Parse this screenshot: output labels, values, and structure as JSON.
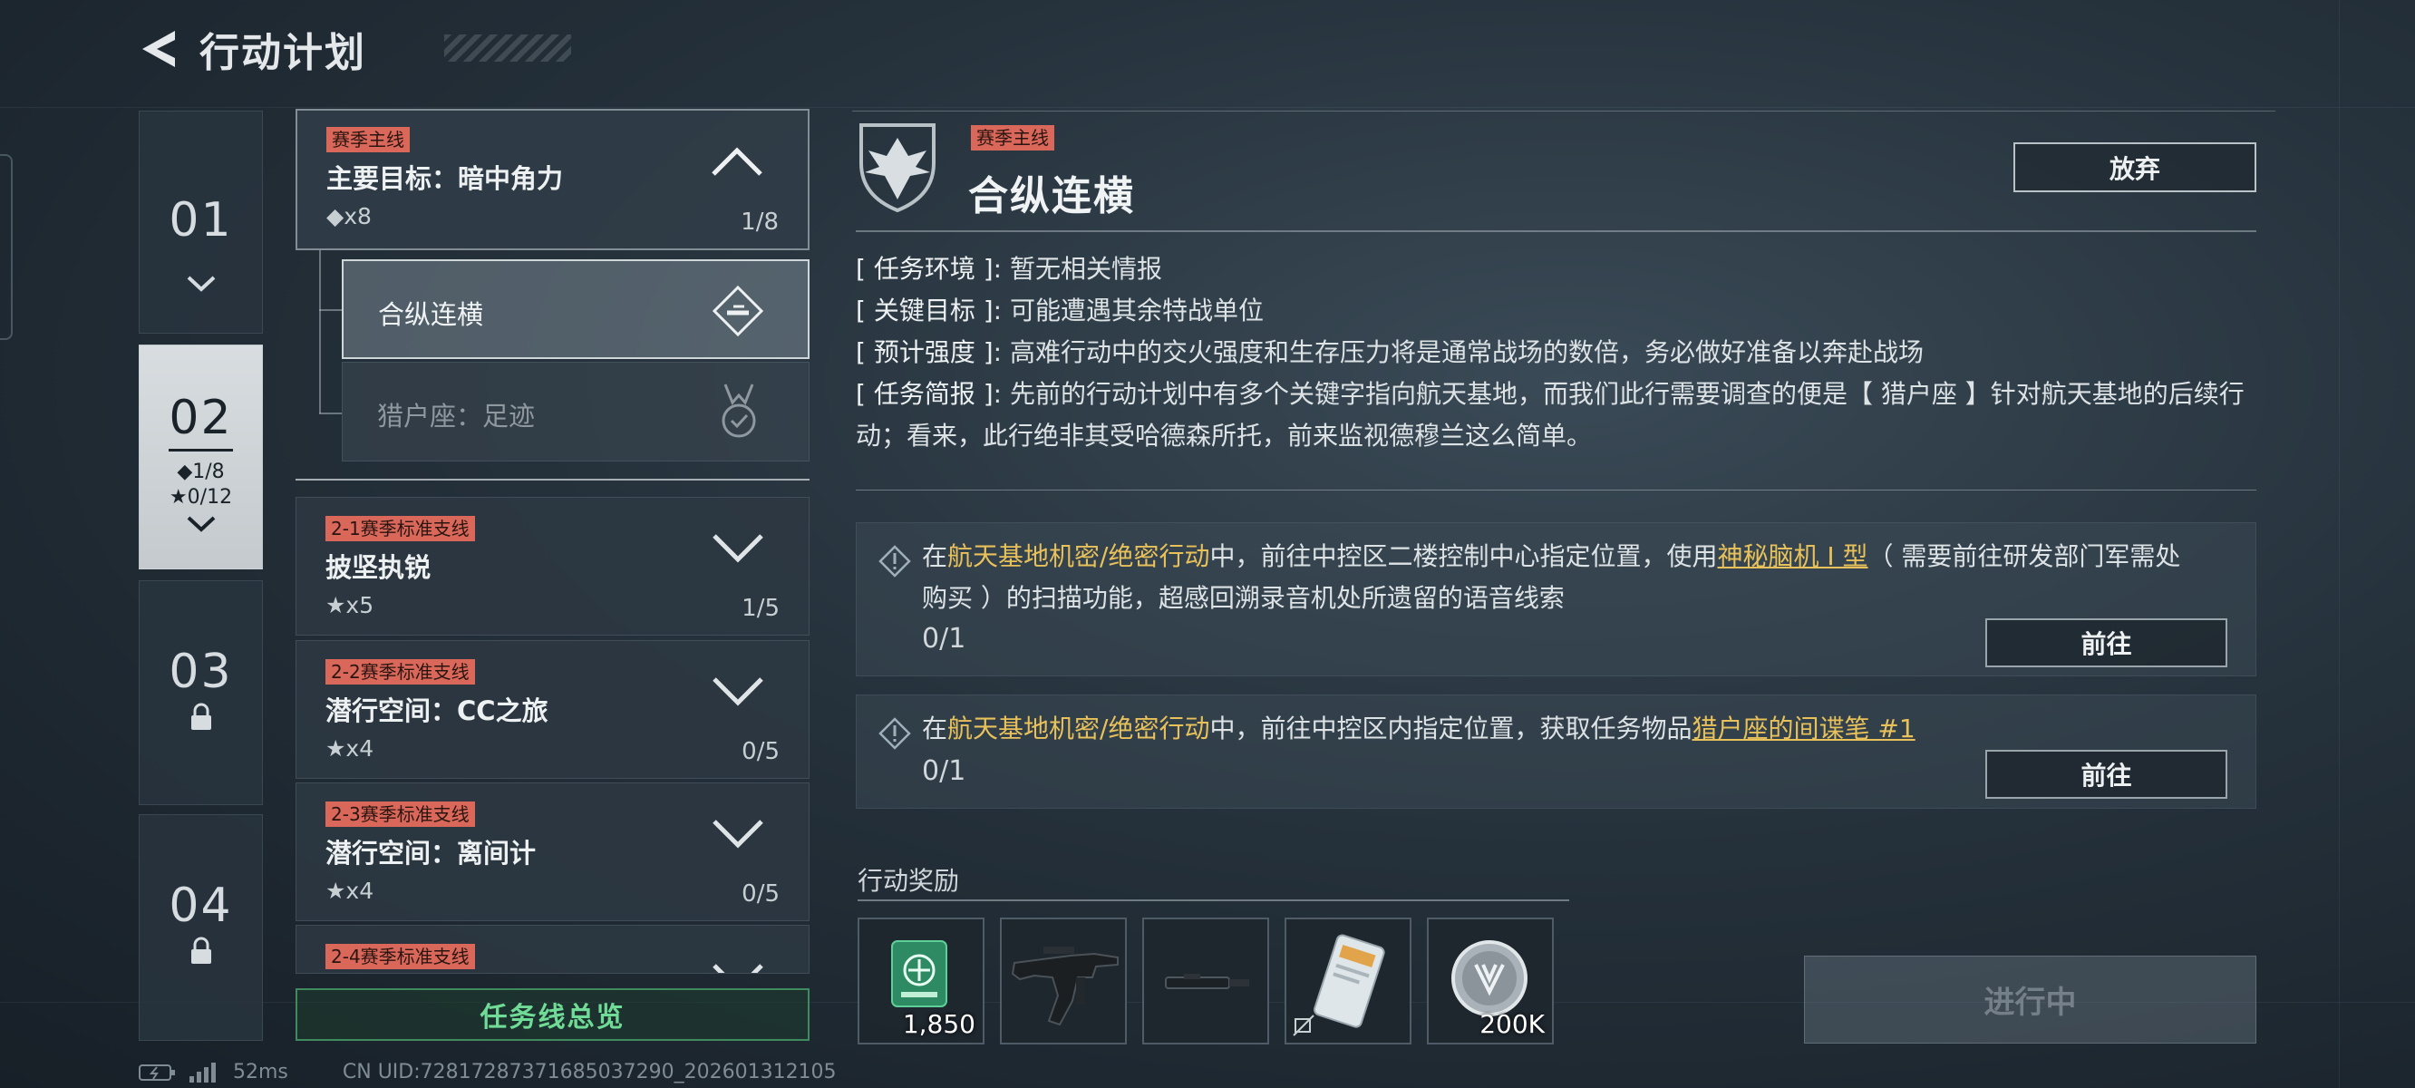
{
  "header": {
    "title": "行动计划"
  },
  "chapters": [
    {
      "num": "01"
    },
    {
      "num": "02",
      "stat_diamond": "1/8",
      "stat_star": "0/12"
    },
    {
      "num": "03"
    },
    {
      "num": "04"
    }
  ],
  "missions": {
    "main": {
      "tag": "赛季主线",
      "name": "主要目标：暗中角力",
      "count": "x8",
      "progress": "1/8"
    },
    "subs": [
      {
        "name": "合纵连横"
      },
      {
        "name": "猎户座：足迹"
      }
    ],
    "branches": [
      {
        "tag": "2-1赛季标准支线",
        "name": "披坚执锐",
        "count": "x5",
        "progress": "1/5"
      },
      {
        "tag": "2-2赛季标准支线",
        "name": "潜行空间：CC之旅",
        "count": "x4",
        "progress": "0/5"
      },
      {
        "tag": "2-3赛季标准支线",
        "name": "潜行空间：离间计",
        "count": "x4",
        "progress": "0/5"
      },
      {
        "tag": "2-4赛季标准支线"
      }
    ],
    "overview_label": "任务线总览"
  },
  "detail": {
    "tag": "赛季主线",
    "title": "合纵连横",
    "abandon_label": "放弃",
    "info": [
      {
        "key": "[ 任务环境 ]",
        "sep": ":  ",
        "value": "暂无相关情报"
      },
      {
        "key": "[ 关键目标 ]",
        "sep": ":  ",
        "value": "可能遭遇其余特战单位"
      },
      {
        "key": "[ 预计强度 ]",
        "sep": ":  ",
        "value": "高难行动中的交火强度和生存压力将是通常战场的数倍，务必做好准备以奔赴战场"
      },
      {
        "key": "[ 任务简报 ]",
        "sep": ":  ",
        "value": "先前的行动计划中有多个关键字指向航天基地，而我们此行需要调查的便是【 猎户座 】针对航天基地的后续行动；看来，此行绝非其受哈德森所托，前来监视德穆兰这么简单。"
      }
    ],
    "objectives": [
      {
        "t1": "在",
        "hl1": "航天基地机密/绝密行动",
        "t2": "中，前往中控区二楼控制中心指定位置，使用",
        "link": "神秘脑机 I 型",
        "t3": "（ 需要前往研发部门军需处购买 ）的扫描功能，超感回溯录音机处所遗留的语音线索",
        "progress": "0/1",
        "button": "前往"
      },
      {
        "t1": "在",
        "hl1": "航天基地机密/绝密行动",
        "t2": "中，前往中控区内指定位置，获取任务物品",
        "link": "猎户座的间谍笔 #1",
        "t3": "",
        "progress": "0/1",
        "button": "前往"
      }
    ],
    "rewards_title": "行动奖励",
    "rewards": [
      {
        "icon": "currency-chip-icon",
        "qty": "1,850"
      },
      {
        "icon": "rifle-icon",
        "qty": ""
      },
      {
        "icon": "attachment-icon",
        "qty": ""
      },
      {
        "icon": "card-item-icon",
        "qty": ""
      },
      {
        "icon": "silver-coin-icon",
        "qty": "200K"
      }
    ],
    "status_button": "进行中"
  },
  "status_bar": {
    "ping": "52ms",
    "uid": "CN UID:7281728737168503729​0_202601312105"
  },
  "colors": {
    "tag_red": "#d9685a",
    "highlight_gold": "#e8c15a",
    "overview_green": "#6fdb96"
  }
}
